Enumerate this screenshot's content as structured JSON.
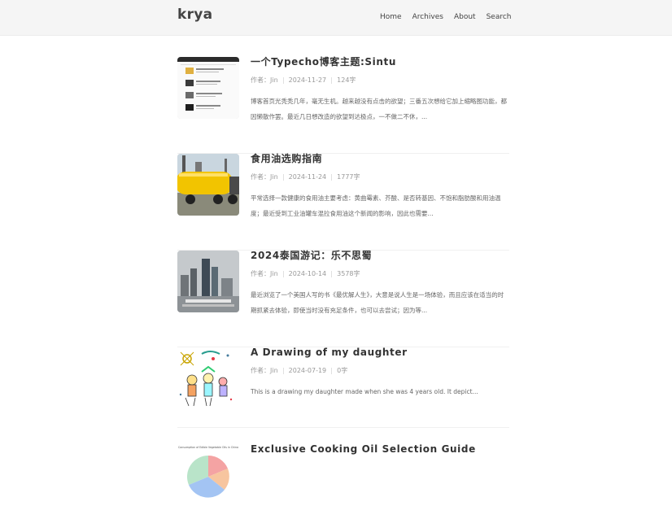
{
  "site": {
    "logo": "krya"
  },
  "nav": [
    {
      "label": "Home"
    },
    {
      "label": "Archives"
    },
    {
      "label": "About"
    },
    {
      "label": "Search"
    }
  ],
  "posts": [
    {
      "title": "一个Typecho博客主题:Sintu",
      "author": "作者：Jin",
      "date": "2024-11-27",
      "words": "124字",
      "excerpt": "博客首页光秃秃几年，毫无生机。越来越没有点击的欲望；三番五次想给它加上缩略图功能，都因懒散作罢。最近几日想改造的欲望到达极点，一不做二不休，..."
    },
    {
      "title": "食用油选购指南",
      "author": "作者：Jin",
      "date": "2024-11-24",
      "words": "1777字",
      "excerpt": "平常选择一款健康的食用油主要考虑：黄曲霉素、芥酸、是否转基因、不饱和脂肪酸和用油温度；最近受到工业油罐车混拉食用油这个新闻的影响，因此也需要..."
    },
    {
      "title": "2024泰国游记：乐不思蜀",
      "author": "作者：Jin",
      "date": "2024-10-14",
      "words": "3578字",
      "excerpt": "最近浏览了一个美国人写的书《最优解人生》，大意是说人生是一场体验，而且应该在适当的时期抓紧去体验，即使当时没有充足条件，也可以去尝试；因为等..."
    },
    {
      "title": "A Drawing of my daughter",
      "author": "作者：Jin",
      "date": "2024-07-19",
      "words": "0字",
      "excerpt": "This is a drawing my daughter made when she was 4 years old. It depict..."
    },
    {
      "title": "Exclusive Cooking Oil Selection Guide",
      "author": "",
      "date": "",
      "words": "",
      "excerpt": "",
      "thumb_caption": "Consumption of Edible Vegetable Oils in China"
    }
  ]
}
